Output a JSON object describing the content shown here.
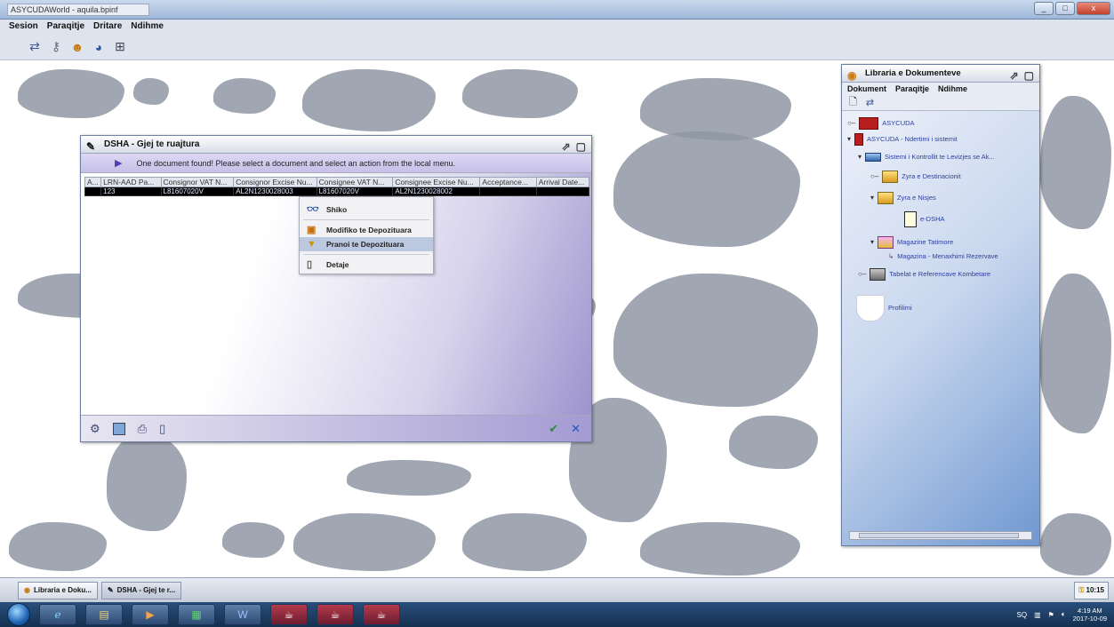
{
  "os": {
    "window_title": "ASYCUDAWorld - aquila.bpinf",
    "window_buttons": [
      "_",
      "□",
      "x"
    ]
  },
  "menubar": {
    "items": [
      "Sesion",
      "Paraqitje",
      "Dritare",
      "Ndihme"
    ]
  },
  "toolbar": {
    "icons": [
      "connect-icon",
      "key-icon",
      "person-icon",
      "person-globe-icon",
      "document-tree-icon"
    ]
  },
  "dsha_window": {
    "title": "DSHA - Gjej te ruajtura",
    "info_message": "One document found! Please select a document and select an action from the local menu.",
    "columns": [
      "A...",
      "LRN-AAD Pa...",
      "Consignor VAT N...",
      "Consignor Excise Nu...",
      "Consignee VAT N...",
      "Consignee Excise Nu...",
      "Acceptance...",
      "Arrival Date..."
    ],
    "rows": [
      [
        "",
        "123",
        "L81607020V",
        "AL2N1230028003",
        "L81607020V",
        "AL2N1230028002",
        "",
        ""
      ]
    ],
    "context_menu": {
      "items": [
        {
          "label": "Shiko",
          "icon": "binoculars-icon"
        },
        {
          "label": "Modifiko te Depozituara",
          "icon": "edit-icon"
        },
        {
          "label": "Pranoi te Depozituara",
          "icon": "accept-icon",
          "selected": true
        },
        {
          "label": "Detaje",
          "icon": "details-icon"
        }
      ]
    }
  },
  "library_window": {
    "title": "Libraria e Dokumenteve",
    "menu": [
      "Dokument",
      "Paraqitje",
      "Ndihme"
    ],
    "tree": [
      {
        "label": "ASYCUDA",
        "level": 0,
        "icon": "red"
      },
      {
        "label": "ASYCUDA - Ndertimi i sistemit",
        "level": 0,
        "icon": "flag"
      },
      {
        "label": "Sistemi i Kontrollit te Levizjes se Ak...",
        "level": 1,
        "icon": "net"
      },
      {
        "label": "Zyra e Destinacionit",
        "level": 2,
        "icon": "folder"
      },
      {
        "label": "Zyra e Nisjes",
        "level": 2,
        "icon": "folder"
      },
      {
        "label": "e-DSHA",
        "level": 3,
        "icon": "doc"
      },
      {
        "label": "Magazine Tatimore",
        "level": 2,
        "icon": "flow"
      },
      {
        "label": "Magazina - Menaxhimi Rezervave",
        "level": 3,
        "icon": "flow"
      },
      {
        "label": "Tabelat e Referencave Kombetare",
        "level": 1,
        "icon": "box"
      },
      {
        "label": "Profilimi",
        "level": 0,
        "icon": "shield"
      }
    ]
  },
  "app_taskbar": {
    "buttons": [
      "Libraria e Doku...",
      "DSHA - Gjej te r..."
    ],
    "clock": "10:15"
  },
  "os_taskbar": {
    "time": "4:19 AM",
    "date": "2017-10-09",
    "tray": "SQ"
  }
}
